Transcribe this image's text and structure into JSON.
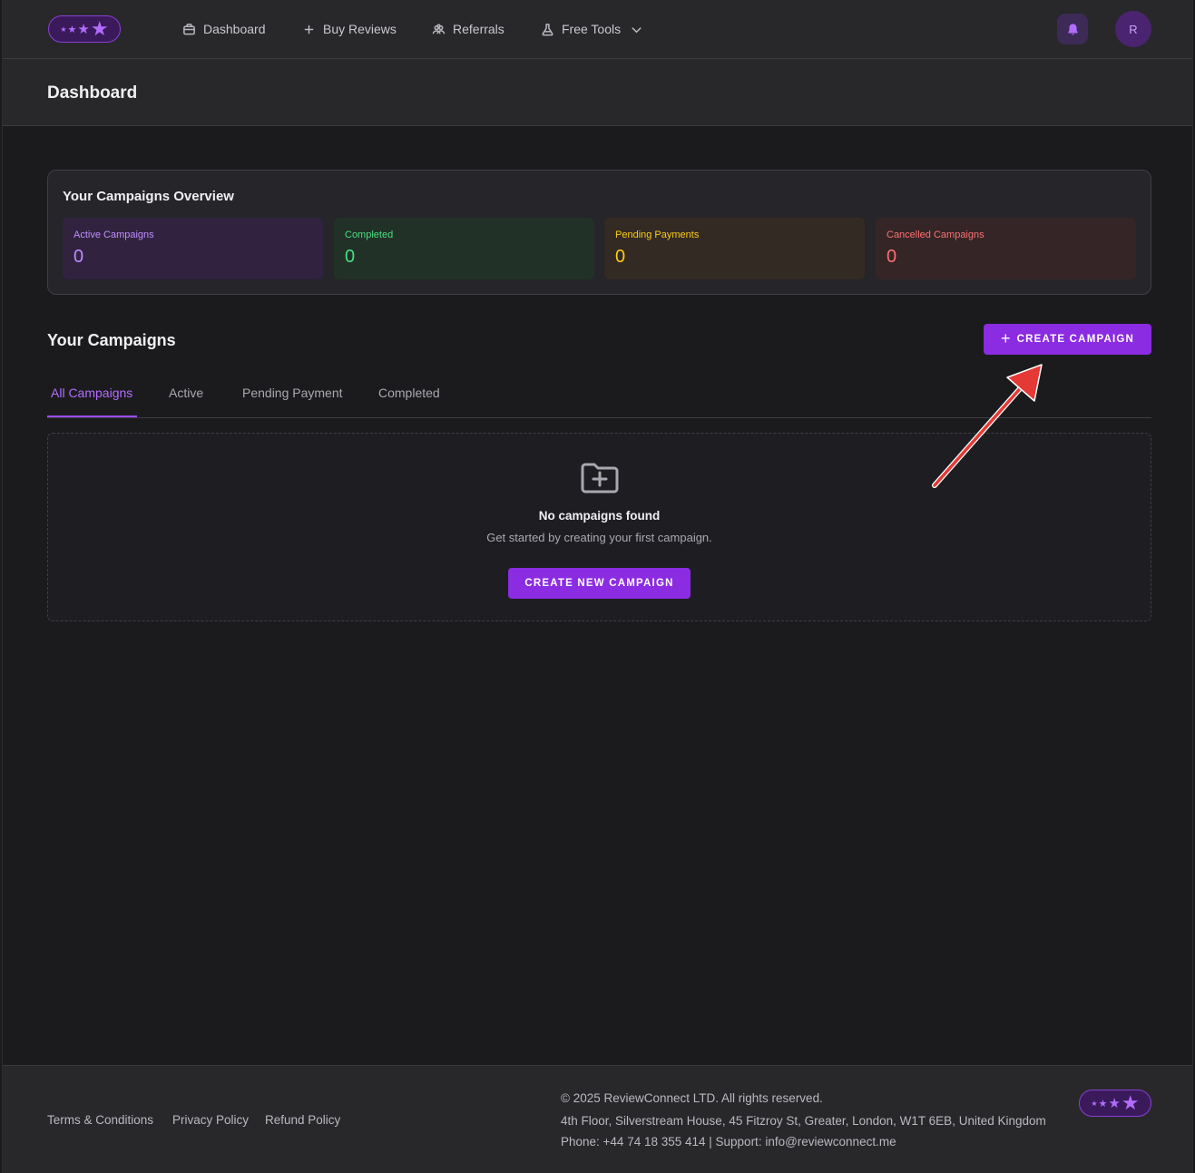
{
  "nav": {
    "items": [
      {
        "label": "Dashboard",
        "icon": "briefcase-icon"
      },
      {
        "label": "Buy Reviews",
        "icon": "plus-icon"
      },
      {
        "label": "Referrals",
        "icon": "users-icon"
      },
      {
        "label": "Free Tools",
        "icon": "flask-icon"
      }
    ],
    "avatar_initial": "R"
  },
  "page": {
    "title": "Dashboard"
  },
  "overview": {
    "title": "Your Campaigns Overview",
    "stats": [
      {
        "label": "Active Campaigns",
        "value": "0",
        "color": "#c08cff"
      },
      {
        "label": "Completed",
        "value": "0",
        "color": "#4ade80"
      },
      {
        "label": "Pending Payments",
        "value": "0",
        "color": "#facc15"
      },
      {
        "label": "Cancelled Campaigns",
        "value": "0",
        "color": "#f87171"
      }
    ]
  },
  "campaigns": {
    "title": "Your Campaigns",
    "create_label": "CREATE CAMPAIGN",
    "tabs": [
      "All Campaigns",
      "Active",
      "Pending Payment",
      "Completed"
    ],
    "empty": {
      "title": "No campaigns found",
      "subtitle": "Get started by creating your first campaign.",
      "button_label": "CREATE NEW CAMPAIGN"
    }
  },
  "footer": {
    "links": [
      "Terms & Conditions",
      "Privacy Policy",
      "Refund Policy"
    ],
    "copyright": "© 2025 ReviewConnect LTD. All rights reserved.",
    "address": "4th Floor, Silverstream House, 45 Fitzroy St, Greater, London, W1T 6EB, United Kingdom",
    "contact": "Phone: +44 74 18 355 414 | Support:  info@reviewconnect.me"
  },
  "colors": {
    "accent": "#8b2be2",
    "background": "#1b1b1e",
    "panel": "#28282b"
  }
}
